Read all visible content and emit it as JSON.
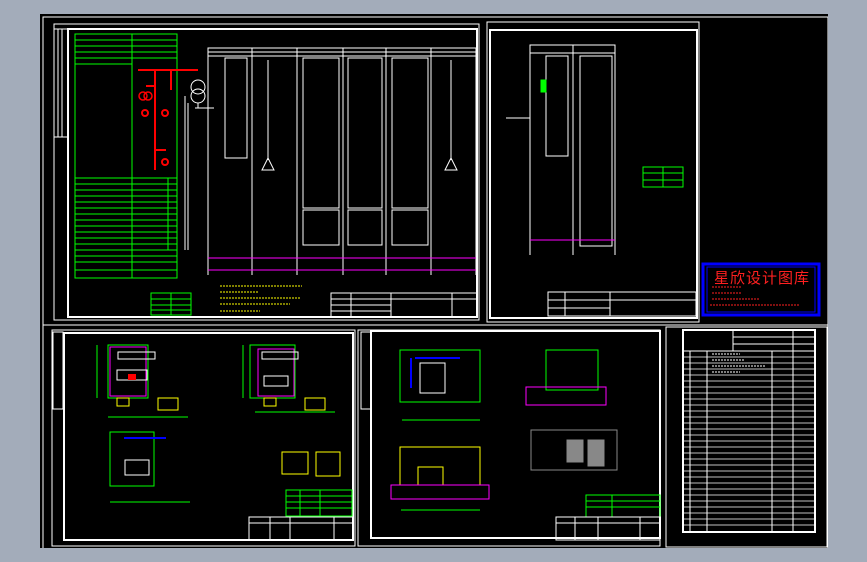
{
  "watermark": {
    "title": "星欣设计图库"
  },
  "colors": {
    "background": "#000000",
    "frame": "#ffffff",
    "table_lines": "#00ff00",
    "busbar": "#ff0000",
    "highlight": "#ff00ff",
    "notes": "#ffff00",
    "conduit": "#0000ff",
    "logo_border": "#0000ff",
    "logo_text": "#ff2020",
    "outer_background": "#a3acba"
  },
  "sheets": [
    {
      "name": "single-line-diagram"
    },
    {
      "name": "low-voltage-branch-diagram"
    },
    {
      "name": "equipment-floor-plans"
    },
    {
      "name": "sections-and-elevations"
    },
    {
      "name": "drawing-index-table"
    }
  ]
}
